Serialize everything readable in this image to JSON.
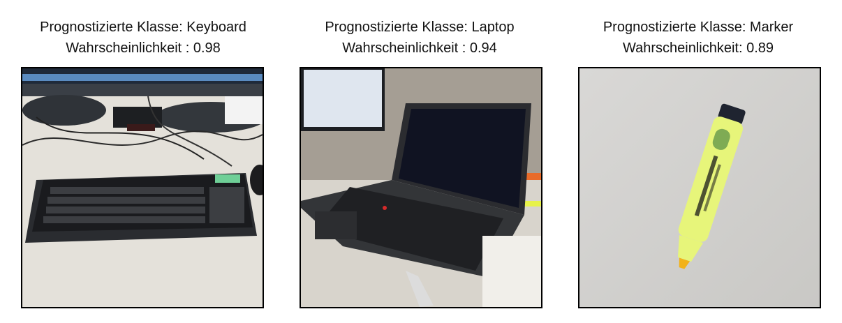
{
  "panels": [
    {
      "class_label": "Prognostizierte Klasse: Keyboard",
      "prob_label": "Wahrscheinlichkeit : 0.98",
      "photo": "keyboard-photo"
    },
    {
      "class_label": "Prognostizierte Klasse: Laptop",
      "prob_label": "Wahrscheinlichkeit : 0.94",
      "photo": "laptop-photo"
    },
    {
      "class_label": "Prognostizierte Klasse: Marker",
      "prob_label": "Wahrscheinlichkeit: 0.89",
      "photo": "marker-photo"
    }
  ]
}
